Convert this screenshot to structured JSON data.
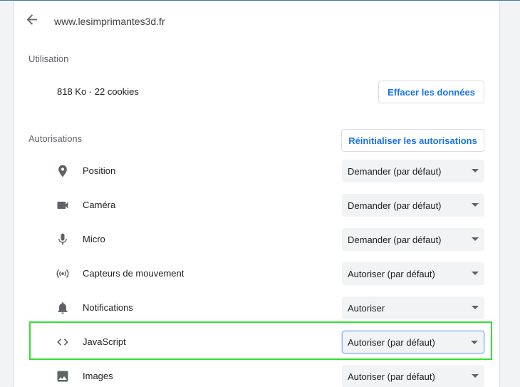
{
  "header": {
    "site": "www.lesimprimantes3d.fr"
  },
  "usage": {
    "label": "Utilisation",
    "summary": "818 Ko · 22 cookies",
    "clear_button": "Effacer les données"
  },
  "permissions": {
    "label": "Autorisations",
    "reset_button": "Réinitialiser les autorisations",
    "items": [
      {
        "key": "position",
        "label": "Position",
        "icon": "location-pin-icon",
        "value": "Demander (par défaut)"
      },
      {
        "key": "camera",
        "label": "Caméra",
        "icon": "camera-icon",
        "value": "Demander (par défaut)"
      },
      {
        "key": "micro",
        "label": "Micro",
        "icon": "microphone-icon",
        "value": "Demander (par défaut)"
      },
      {
        "key": "motion-sensors",
        "label": "Capteurs de mouvement",
        "icon": "motion-sensor-icon",
        "value": "Autoriser (par défaut)"
      },
      {
        "key": "notifications",
        "label": "Notifications",
        "icon": "bell-icon",
        "value": "Autoriser"
      },
      {
        "key": "javascript",
        "label": "JavaScript",
        "icon": "code-brackets-icon",
        "value": "Autoriser (par défaut)",
        "focused": true
      },
      {
        "key": "images",
        "label": "Images",
        "icon": "image-icon",
        "value": "Autoriser (par défaut)"
      }
    ]
  },
  "colors": {
    "accent": "#1a73e8",
    "highlight": "#2ee22e",
    "select_bg": "#f1f3f4"
  }
}
